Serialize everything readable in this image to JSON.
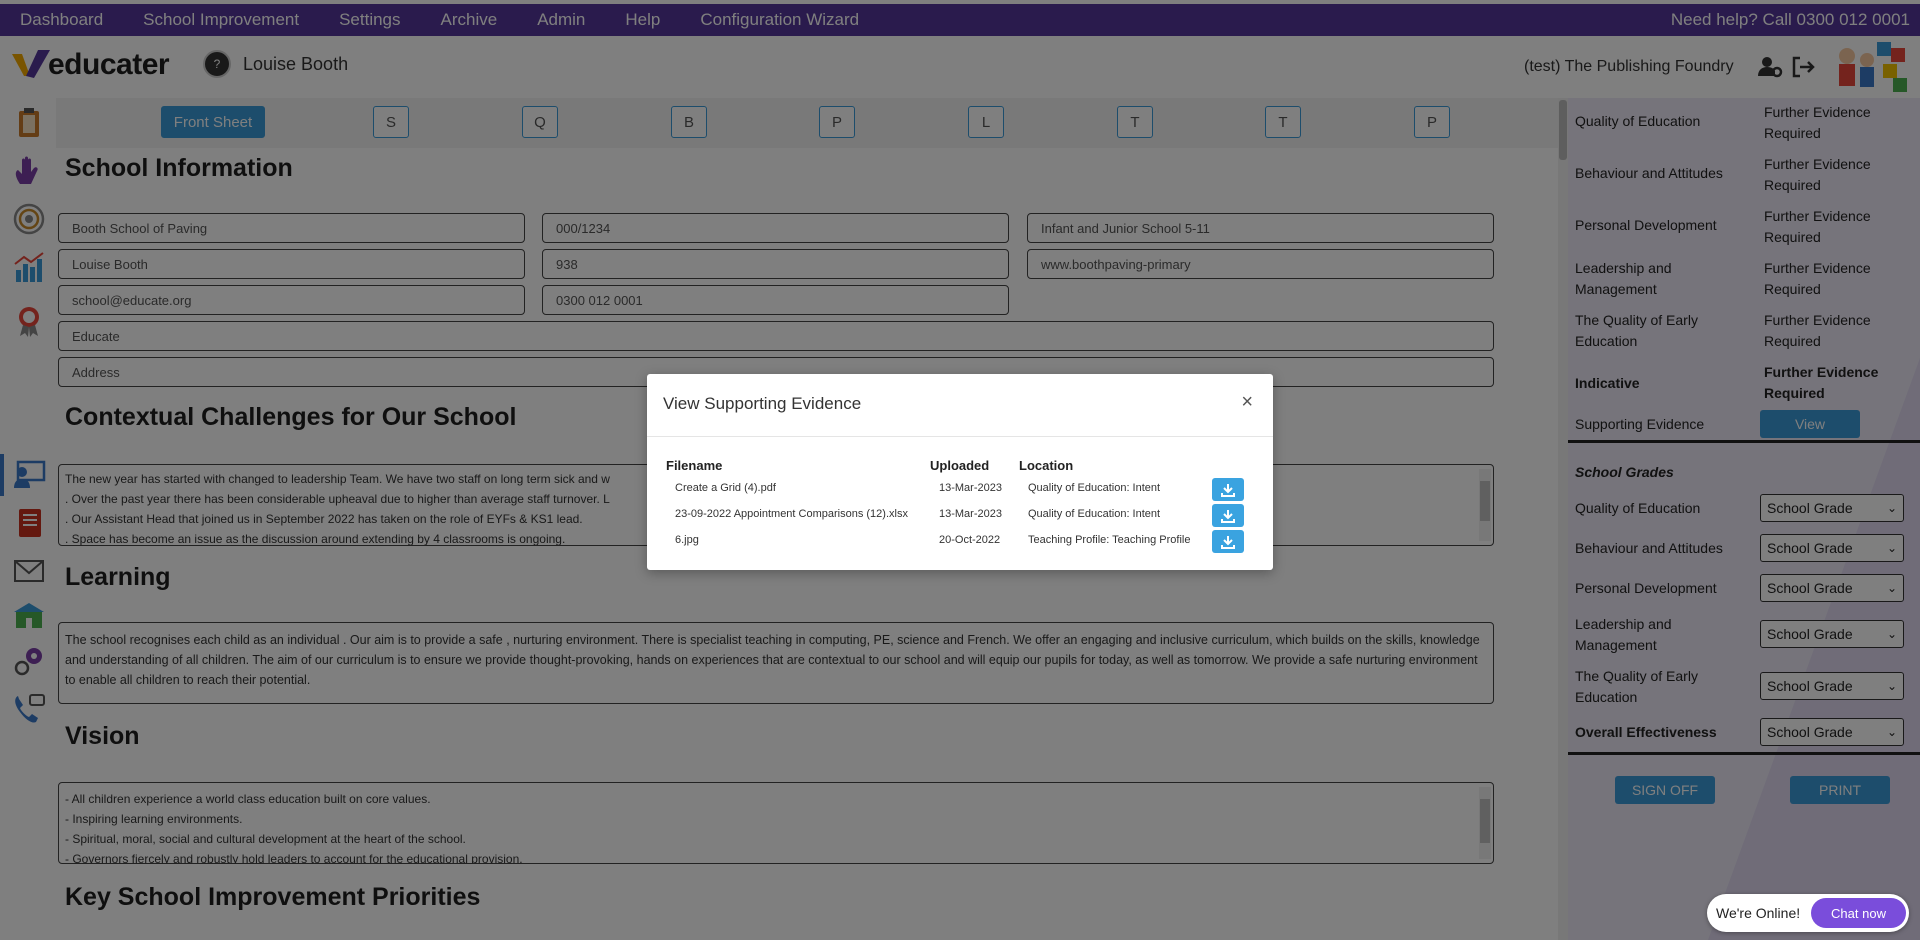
{
  "topnav": {
    "items": [
      "Dashboard",
      "School Improvement",
      "Settings",
      "Archive",
      "Admin",
      "Help",
      "Configuration Wizard"
    ],
    "help": "Need help?   Call 0300 012 0001"
  },
  "header": {
    "logo": "educater",
    "avatar_letter": "?",
    "user_name": "Louise Booth",
    "org_name": "(test) The Publishing Foundry"
  },
  "letters": {
    "front_sheet": "Front Sheet",
    "items": [
      "S",
      "Q",
      "B",
      "P",
      "L",
      "T",
      "T",
      "P"
    ]
  },
  "school_info": {
    "title": "School Information",
    "school_name": "Booth School of Paving",
    "urn": "000/1234",
    "phase": "Infant and Junior School 5-11",
    "head": "Louise Booth",
    "pupils": "938",
    "website": "www.boothpaving-primary",
    "email": "school@educate.org",
    "phone": "0300 012 0001",
    "group": "Educate",
    "address": "Address"
  },
  "contextual": {
    "title": "Contextual Challenges for Our School",
    "lines": [
      "The new year has started with changed to leadership Team.  We have two staff on long term sick and w",
      ". Over the past year there has been considerable upheaval  due to higher than average staff turnover. L",
      ". Our Assistant Head that joined us in September 2022 has taken on the role of EYFs & KS1 lead.",
      ". Space has become an issue as the discussion around extending by 4 classrooms is ongoing."
    ]
  },
  "learning": {
    "title": "Learning",
    "text": "The school recognises each child as an individual . Our aim is to provide a safe , nurturing environment. There is specialist teaching in computing, PE, science and French. We offer an engaging and inclusive curriculum, which builds on the skills, knowledge and understanding of all children. The aim of our curriculum is to ensure we provide thought-provoking, hands on experiences that are contextual to our school and will equip our pupils for today, as well as tomorrow. We provide a safe nurturing environment to enable all children to reach their potential."
  },
  "vision": {
    "title": "Vision",
    "lines": [
      "- All children experience a world class education built on core values.",
      "- Inspiring learning environments.",
      "- Spiritual, moral, social and cultural development at the heart of the school.",
      "- Governors fiercely and robustly hold leaders to account for the educational provision."
    ]
  },
  "priorities": {
    "title": "Key School Improvement Priorities"
  },
  "right_panel": {
    "judgements": [
      {
        "label": "Quality of Education",
        "value": "Further Evidence Required"
      },
      {
        "label": "Behaviour and Attitudes",
        "value": "Further Evidence Required"
      },
      {
        "label": "Personal Development",
        "value": "Further Evidence Required"
      },
      {
        "label": "Leadership and Management",
        "value": "Further Evidence Required"
      },
      {
        "label": "The Quality of Early Education",
        "value": "Further Evidence Required"
      }
    ],
    "indicative_label": "Indicative",
    "indicative_value": "Further Evidence Required",
    "supporting_label": "Supporting Evidence",
    "view_button": "View",
    "school_grades_title": "School Grades",
    "grades": [
      {
        "label": "Quality of Education",
        "value": "School Grade"
      },
      {
        "label": "Behaviour and Attitudes",
        "value": "School Grade"
      },
      {
        "label": "Personal Development",
        "value": "School Grade"
      },
      {
        "label": "Leadership and Management",
        "value": "School Grade"
      },
      {
        "label": "The Quality of Early Education",
        "value": "School Grade"
      }
    ],
    "overall_label": "Overall Effectiveness",
    "overall_value": "School Grade",
    "sign_off": "SIGN OFF",
    "print": "PRINT"
  },
  "modal": {
    "title": "View Supporting Evidence",
    "close": "×",
    "columns": [
      "Filename",
      "Uploaded",
      "Location"
    ],
    "rows": [
      {
        "filename": "Create a Grid (4).pdf",
        "uploaded": "13-Mar-2023",
        "location": "Quality of Education: Intent"
      },
      {
        "filename": "23-09-2022 Appointment Comparisons (12).xlsx",
        "uploaded": "13-Mar-2023",
        "location": "Quality of Education: Intent"
      },
      {
        "filename": "6.jpg",
        "uploaded": "20-Oct-2022",
        "location": "Teaching Profile: Teaching Profile"
      }
    ]
  },
  "chat": {
    "status": "We're Online!",
    "button": "Chat now"
  },
  "colors": {
    "nav": "#54369a",
    "accent": "#3a9ad9",
    "panel": "#ece8f6",
    "chat": "#7a4ddb"
  }
}
